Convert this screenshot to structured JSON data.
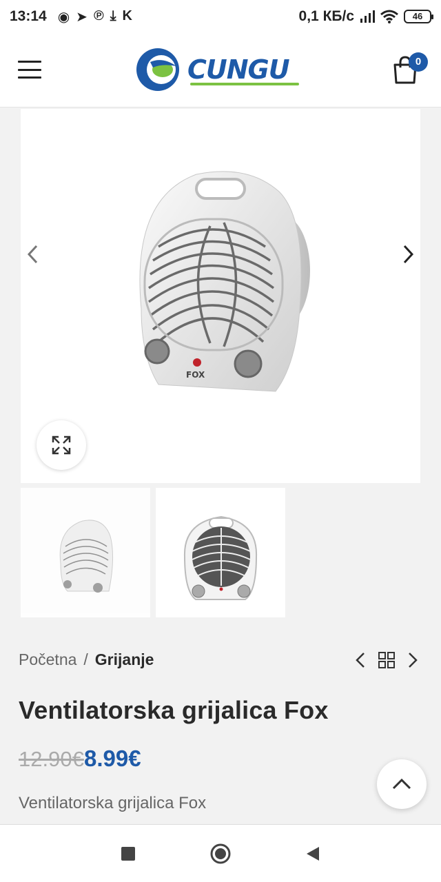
{
  "status_bar": {
    "time": "13:14",
    "app_icons": [
      "whatsapp-icon",
      "telegram-icon",
      "pinterest-icon",
      "download-icon",
      "k-icon"
    ],
    "app_glyphs": [
      "◉",
      "➤",
      "℗",
      "⤓",
      "K"
    ],
    "network_speed": "0,1 КБ/с",
    "battery": "46"
  },
  "header": {
    "logo_text": "CUNGU",
    "cart_count": "0",
    "colors": {
      "brand_blue": "#1e5aa8",
      "brand_green": "#7cc242"
    }
  },
  "product": {
    "breadcrumb": {
      "home": "Početna",
      "separator": "/",
      "current": "Grijanje"
    },
    "title": "Ventilatorska grijalica Fox",
    "price_old": "12.90€",
    "price_new": "8.99€",
    "description": "Ventilatorska grijalica Fox",
    "image_brand_label": "FOX"
  },
  "icons": {
    "prev": "chevron-left-icon",
    "next": "chevron-right-icon",
    "zoom": "expand-icon",
    "scroll_top": "chevron-up-icon",
    "grid": "grid-icon"
  },
  "nav_bar": [
    "recent-apps-button",
    "home-button",
    "back-button"
  ]
}
